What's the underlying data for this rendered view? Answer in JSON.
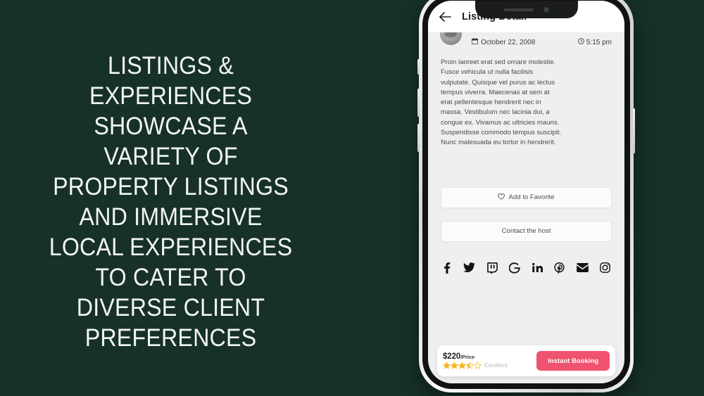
{
  "background_color": "#17302a",
  "headline": {
    "text": "LISTINGS &\nEXPERIENCES\nSHOWCASE A\nVARIETY OF\nPROPERTY LISTINGS\nAND IMMERSIVE\nLOCAL EXPERIENCES\nTO CATER TO\nDIVERSE CLIENT\nPREFERENCES",
    "color": "#f2f5f2"
  },
  "phone": {
    "app": {
      "header": {
        "back_icon": "back-arrow-icon",
        "title": "Listing Detail"
      },
      "post": {
        "avatar": "user-avatar",
        "date_icon": "calendar-icon",
        "date": "October 22, 2008",
        "time_icon": "clock-icon",
        "time": "5:15 pm",
        "body": "Proin laoreet erat sed ornare molestie. Fusce vehicula ut nulla facilisis vulputate. Quisque vel purus ac lectus tempus viverra. Maecenas at sem at erat pellentesque hendrerit nec in massa. Vestibulum nec lacinia dui, a congue ex. Vivamus ac ultricies mauris. Suspendisse commodo tempus suscipit. Nunc malesuada eu tortor in hendrerit."
      },
      "actions": {
        "favorite_icon": "heart-icon",
        "favorite_label": "Add to Favorite",
        "contact_label": "Contact the host"
      },
      "social": [
        {
          "name": "facebook-icon",
          "label": "Facebook"
        },
        {
          "name": "twitter-icon",
          "label": "Twitter"
        },
        {
          "name": "twitch-icon",
          "label": "Twitch"
        },
        {
          "name": "google-icon",
          "label": "Google"
        },
        {
          "name": "linkedin-icon",
          "label": "LinkedIn"
        },
        {
          "name": "pinterest-icon",
          "label": "Pinterest"
        },
        {
          "name": "email-icon",
          "label": "Email"
        },
        {
          "name": "instagram-icon",
          "label": "Instagram"
        }
      ],
      "bottom_bar": {
        "price": "$220",
        "price_unit": "/Price",
        "rating_value": 3.5,
        "rating_max": 5,
        "rating_word": "Excellent",
        "star_color": "#f5b622",
        "booking_label": "Instant Booking",
        "booking_color": "#ef5370"
      }
    }
  }
}
